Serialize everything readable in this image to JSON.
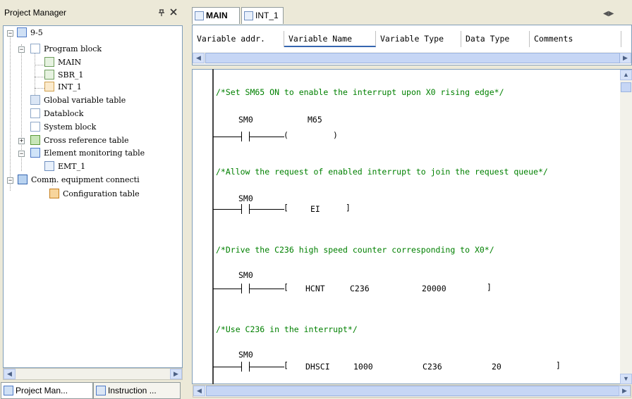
{
  "left_panel": {
    "title": "Project Manager",
    "pin_glyph": "p",
    "close_glyph": "×",
    "tree": {
      "root": "9-5",
      "program_block": "Program block",
      "main": "MAIN",
      "sbr": "SBR_1",
      "int": "INT_1",
      "global_vars": "Global variable table",
      "datablock": "Datablock",
      "system_block": "System block",
      "cross_ref": "Cross reference table",
      "element_monitor": "Element monitoring table",
      "emt": "EMT_1",
      "comm": "Comm. equipment connecti",
      "config_table": "Configuration table"
    },
    "bottom_tabs": [
      "Project Man...",
      "Instruction ..."
    ]
  },
  "editor": {
    "tabs": [
      "MAIN",
      "INT_1"
    ],
    "var_columns": [
      "Variable addr.",
      "Variable Name",
      "Variable Type",
      "Data Type",
      "Comments"
    ],
    "networks": [
      {
        "comment": "/*Set SM65 ON to enable the interrupt upon X0 rising edge*/",
        "contact": "SM0",
        "coil": "M65",
        "coil_open": "(",
        "coil_close": ")"
      },
      {
        "comment": "/*Allow the request of enabled interrupt to join the request queue*/",
        "contact": "SM0",
        "box_open": "[",
        "instr": "EI",
        "box_close": "]"
      },
      {
        "comment": "/*Drive the C236 high speed counter corresponding to X0*/",
        "contact": "SM0",
        "box_open": "[",
        "instr": "HCNT",
        "op1": "C236",
        "op2": "20000",
        "box_close": "]"
      },
      {
        "comment": "/*Use C236 in the interrupt*/",
        "contact": "SM0",
        "box_open": "[",
        "instr": "DHSCI",
        "op1": "1000",
        "op2": "C236",
        "op3": "20",
        "box_close": "]"
      }
    ]
  },
  "colors": {
    "comment": "#008000",
    "panel_bg": "#ece9d8",
    "border": "#7f9db9"
  }
}
